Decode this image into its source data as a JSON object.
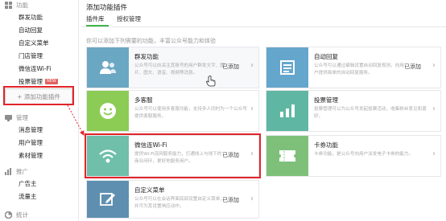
{
  "sidebar": {
    "sections": [
      {
        "title": "功能",
        "items": [
          {
            "label": "群发功能",
            "badge": ""
          },
          {
            "label": "自动回复",
            "badge": ""
          },
          {
            "label": "自定义菜单",
            "badge": ""
          },
          {
            "label": "门店管理",
            "badge": ""
          },
          {
            "label": "微信连Wi-Fi",
            "badge": ""
          },
          {
            "label": "投票管理",
            "badge": "NEW"
          }
        ]
      },
      {
        "title": "管理",
        "items": [
          {
            "label": "消息管理",
            "badge": ""
          },
          {
            "label": "用户管理",
            "badge": ""
          },
          {
            "label": "素材管理",
            "badge": ""
          }
        ]
      },
      {
        "title": "推广",
        "items": [
          {
            "label": "广告主",
            "badge": ""
          },
          {
            "label": "流量主",
            "badge": ""
          }
        ]
      },
      {
        "title": "统计",
        "items": []
      }
    ],
    "add_plugin_label": "+ 添加功能插件"
  },
  "main": {
    "title": "添加功能插件",
    "tabs": [
      {
        "label": "插件库",
        "active": true
      },
      {
        "label": "授权管理",
        "active": false
      }
    ],
    "description": "你可以添加下列需要的功能，丰富公众号能力和体验",
    "plugins": [
      {
        "title": "群发功能",
        "desc": "公众号可以向关注其账号的用户群发文字、图片、图文、语音、视频等消息。",
        "status": "已添加",
        "icon": "users-icon",
        "color": "#6aa7c3"
      },
      {
        "title": "自动回复",
        "desc": "公众号可以通过编辑设置自动回复规则，向用户提供简单的自动回复服务。",
        "status": "已添加",
        "icon": "document-icon",
        "color": "#64a6cc"
      },
      {
        "title": "多客服",
        "desc": "公众号可以使用多客服功能，支持多人同时为一个公众号提供客服服务。",
        "status": "",
        "icon": "smile-icon",
        "color": "#8ccc55"
      },
      {
        "title": "投票管理",
        "desc": "投票管理可以为公众号发起投票活动，收集粉丝意见和喜好。",
        "status": "",
        "icon": "bar-chart-icon",
        "color": "#5fb7a3"
      },
      {
        "title": "微信连Wi-Fi",
        "desc": "提供Wi-Fi连网服务能力，打通线上与线下的商业闭环，更好地服务用户。",
        "status": "已添加",
        "icon": "wifi-icon",
        "color": "#6fbfaa"
      },
      {
        "title": "卡券功能",
        "desc": "卡券功能，是公众号向用户派发电子卡券的能力。",
        "status": "",
        "icon": "ticket-icon",
        "color": "#7ec07a"
      },
      {
        "title": "自定义菜单",
        "desc": "公众号可以在会话界面底部设置自定义菜单，并可为其设置响应动作。",
        "status": "已添加",
        "icon": "edit-icon",
        "color": "#5f8fb0"
      }
    ]
  }
}
